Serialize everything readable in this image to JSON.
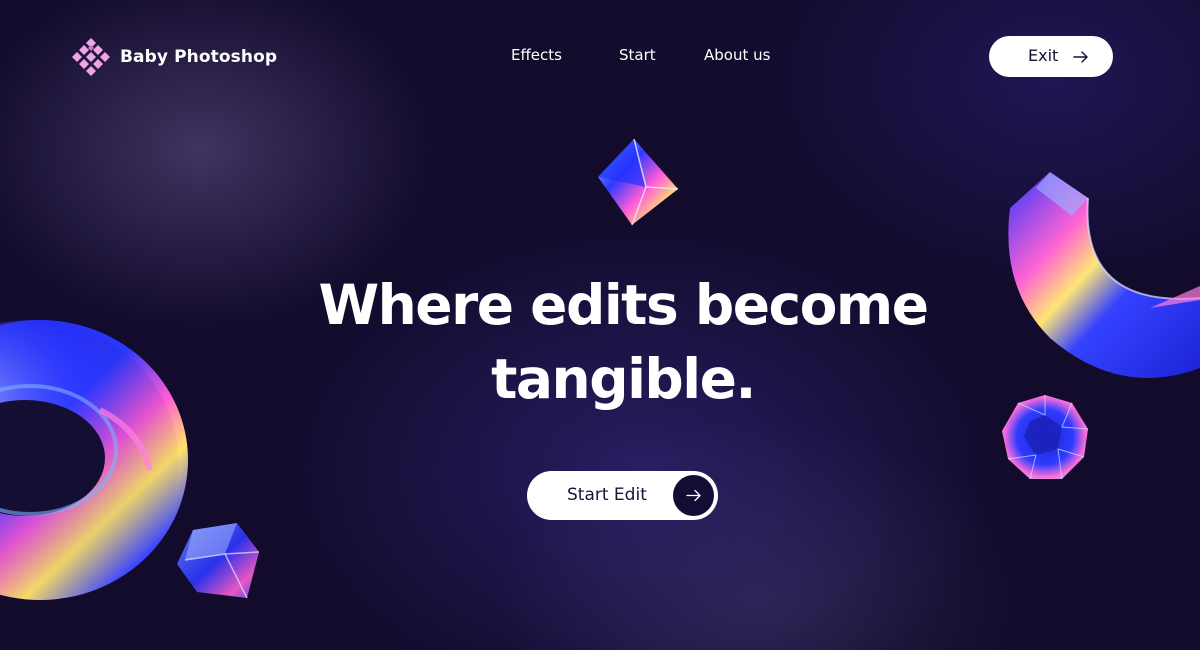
{
  "brand": {
    "name": "Baby Photoshop",
    "logo_icon": "diamond-grid-logo-icon",
    "logo_color": "#f2a3e8"
  },
  "nav": {
    "items": [
      {
        "label": "Effects"
      },
      {
        "label": "Start"
      },
      {
        "label": "About us"
      }
    ]
  },
  "header": {
    "exit_label": "Exit",
    "exit_icon": "arrow-right-icon"
  },
  "hero": {
    "title": "Where edits become tangible.",
    "cta_label": "Start Edit",
    "cta_icon": "arrow-right-icon"
  },
  "decorations": [
    "holographic-torus",
    "holographic-cube",
    "holographic-octahedron",
    "holographic-arc",
    "holographic-gem"
  ],
  "colors": {
    "background": "#120b2c",
    "button_bg": "#ffffff",
    "button_text": "#15102f",
    "accent_blue": "#2f3bff",
    "accent_pink": "#ff4fd8"
  }
}
